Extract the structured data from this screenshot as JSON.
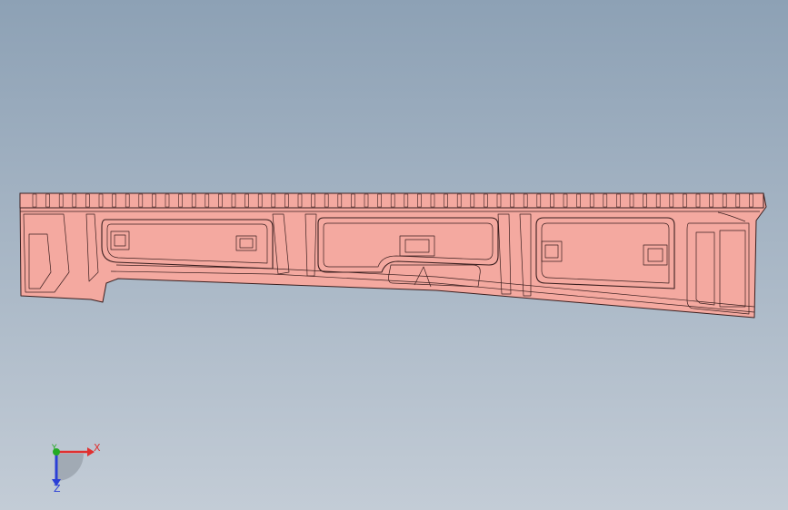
{
  "viewport": {
    "background_top": "#8da1b5",
    "background_bottom": "#c3ccd6"
  },
  "model": {
    "fill_color": "#f4a9a0",
    "edge_color": "#3a1f1f"
  },
  "triad": {
    "x_label": "X",
    "y_label": "Y",
    "z_label": "Z",
    "x_color": "#e03030",
    "y_color": "#22aa22",
    "z_color": "#2b3fd6"
  }
}
